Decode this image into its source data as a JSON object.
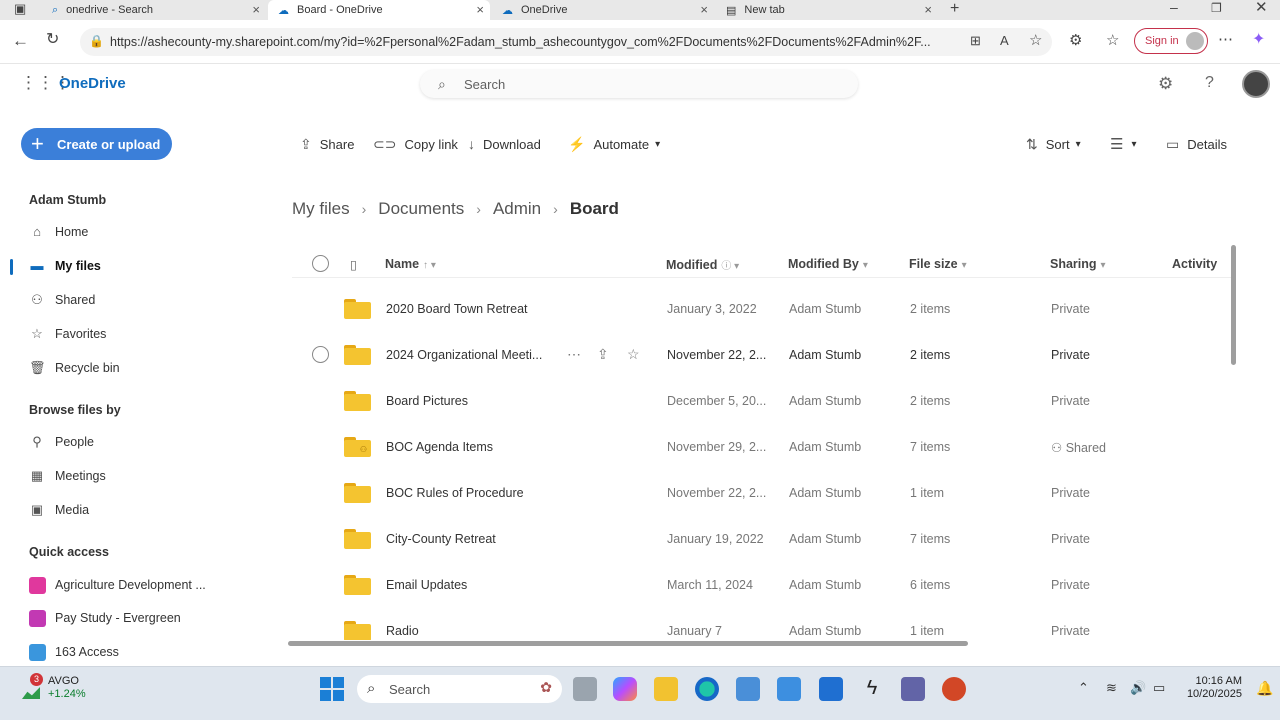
{
  "browser": {
    "tabs": [
      {
        "title": "onedrive - Search",
        "active": false
      },
      {
        "title": "Board - OneDrive",
        "active": true
      },
      {
        "title": "OneDrive",
        "active": false
      },
      {
        "title": "New tab",
        "active": false
      }
    ],
    "url": "https://ashecounty-my.sharepoint.com/my?id=%2Fpersonal%2Fadam_stumb_ashecountygov_com%2FDocuments%2FDocuments%2FAdmin%2F...",
    "sign_in_label": "Sign in"
  },
  "app": {
    "brand": "OneDrive",
    "search_placeholder": "Search"
  },
  "sidebar": {
    "create_label": "Create or upload",
    "user_name": "Adam Stumb",
    "nav": [
      {
        "label": "Home",
        "icon": "home-icon"
      },
      {
        "label": "My files",
        "icon": "folder-icon",
        "selected": true
      },
      {
        "label": "Shared",
        "icon": "people-icon"
      },
      {
        "label": "Favorites",
        "icon": "star-icon"
      },
      {
        "label": "Recycle bin",
        "icon": "trash-icon"
      }
    ],
    "browse_title": "Browse files by",
    "browse": [
      {
        "label": "People",
        "icon": "person-icon"
      },
      {
        "label": "Meetings",
        "icon": "calendar-icon"
      },
      {
        "label": "Media",
        "icon": "image-icon"
      }
    ],
    "quick_title": "Quick access",
    "quick": [
      {
        "label": "Agriculture Development ...",
        "color": "#e0389d"
      },
      {
        "label": "Pay Study - Evergreen",
        "color": "#c239b3"
      },
      {
        "label": "163 Access",
        "color": "#3a96dd"
      }
    ]
  },
  "commands": {
    "share": "Share",
    "copy_link": "Copy link",
    "download": "Download",
    "automate": "Automate",
    "sort": "Sort",
    "details": "Details"
  },
  "breadcrumb": [
    "My files",
    "Documents",
    "Admin",
    "Board"
  ],
  "columns": {
    "name": "Name",
    "modified": "Modified",
    "modified_by": "Modified By",
    "file_size": "File size",
    "sharing": "Sharing",
    "activity": "Activity"
  },
  "rows": [
    {
      "name": "2020 Board Town Retreat",
      "modified": "January 3, 2022",
      "by": "Adam Stumb",
      "size": "2 items",
      "sharing": "Private"
    },
    {
      "name": "2024 Organizational Meeti...",
      "modified": "November 22, 2...",
      "by": "Adam Stumb",
      "size": "2 items",
      "sharing": "Private",
      "hover": true
    },
    {
      "name": "Board Pictures",
      "modified": "December 5, 20...",
      "by": "Adam Stumb",
      "size": "2 items",
      "sharing": "Private"
    },
    {
      "name": "BOC Agenda Items",
      "modified": "November 29, 2...",
      "by": "Adam Stumb",
      "size": "7 items",
      "sharing": "Shared",
      "shared": true
    },
    {
      "name": "BOC Rules of Procedure",
      "modified": "November 22, 2...",
      "by": "Adam Stumb",
      "size": "1 item",
      "sharing": "Private"
    },
    {
      "name": "City-County Retreat",
      "modified": "January 19, 2022",
      "by": "Adam Stumb",
      "size": "7 items",
      "sharing": "Private"
    },
    {
      "name": "Email Updates",
      "modified": "March 11, 2024",
      "by": "Adam Stumb",
      "size": "6 items",
      "sharing": "Private"
    },
    {
      "name": "Radio",
      "modified": "January 7",
      "by": "Adam Stumb",
      "size": "1 item",
      "sharing": "Private"
    }
  ],
  "taskbar": {
    "stock_badge": "3",
    "stock_symbol": "AVGO",
    "stock_change": "+1.24%",
    "search_label": "Search",
    "time": "10:16 AM",
    "date": "10/20/2025"
  }
}
